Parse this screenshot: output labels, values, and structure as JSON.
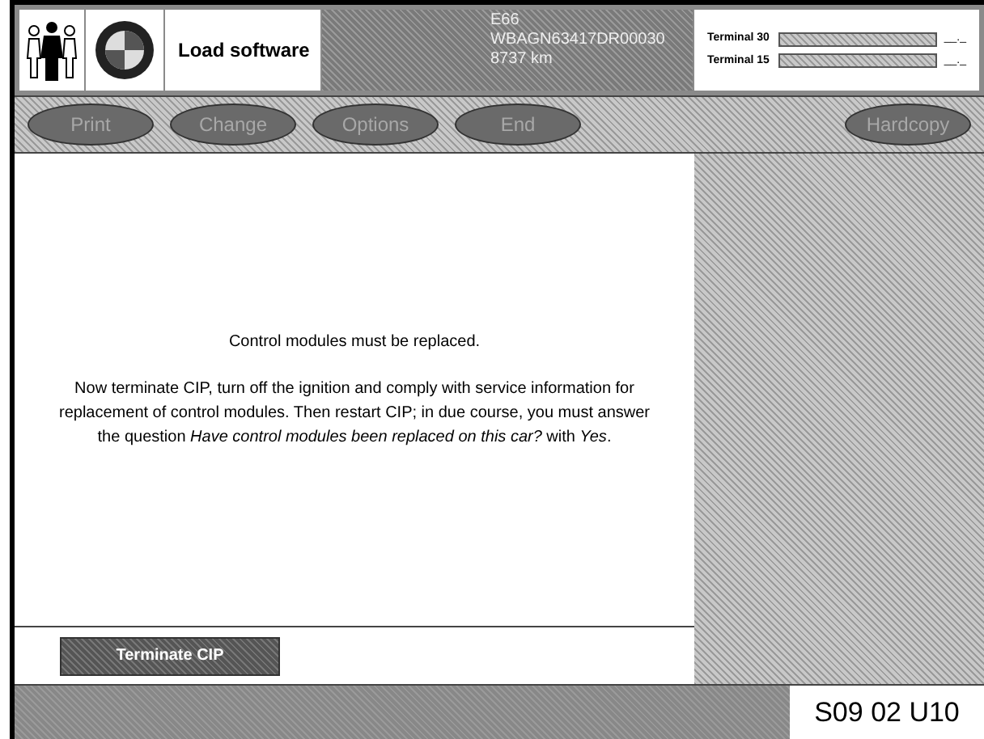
{
  "header": {
    "title": "Load software",
    "model": "E66",
    "vin": "WBAGN63417DR00030",
    "mileage": "8737 km",
    "terminals": [
      {
        "label": "Terminal 30",
        "reading": "__._"
      },
      {
        "label": "Terminal 15",
        "reading": "__._"
      }
    ]
  },
  "toolbar": {
    "buttons": [
      {
        "label": "Print",
        "disabled": true
      },
      {
        "label": "Change",
        "disabled": true
      },
      {
        "label": "Options",
        "disabled": true
      },
      {
        "label": "End",
        "disabled": true
      }
    ],
    "right_button": {
      "label": "Hardcopy",
      "disabled": true
    }
  },
  "message": {
    "heading": "Control modules must be replaced.",
    "body": "Now terminate CIP, turn off the ignition and comply with service information for replacement of control modules. Then restart CIP; in due course, you must answer the question *Have control modules been replaced on this car?* with *Yes*."
  },
  "action_button": {
    "label": "Terminate CIP"
  },
  "status_bar": {
    "code": "S09 02 U10"
  }
}
